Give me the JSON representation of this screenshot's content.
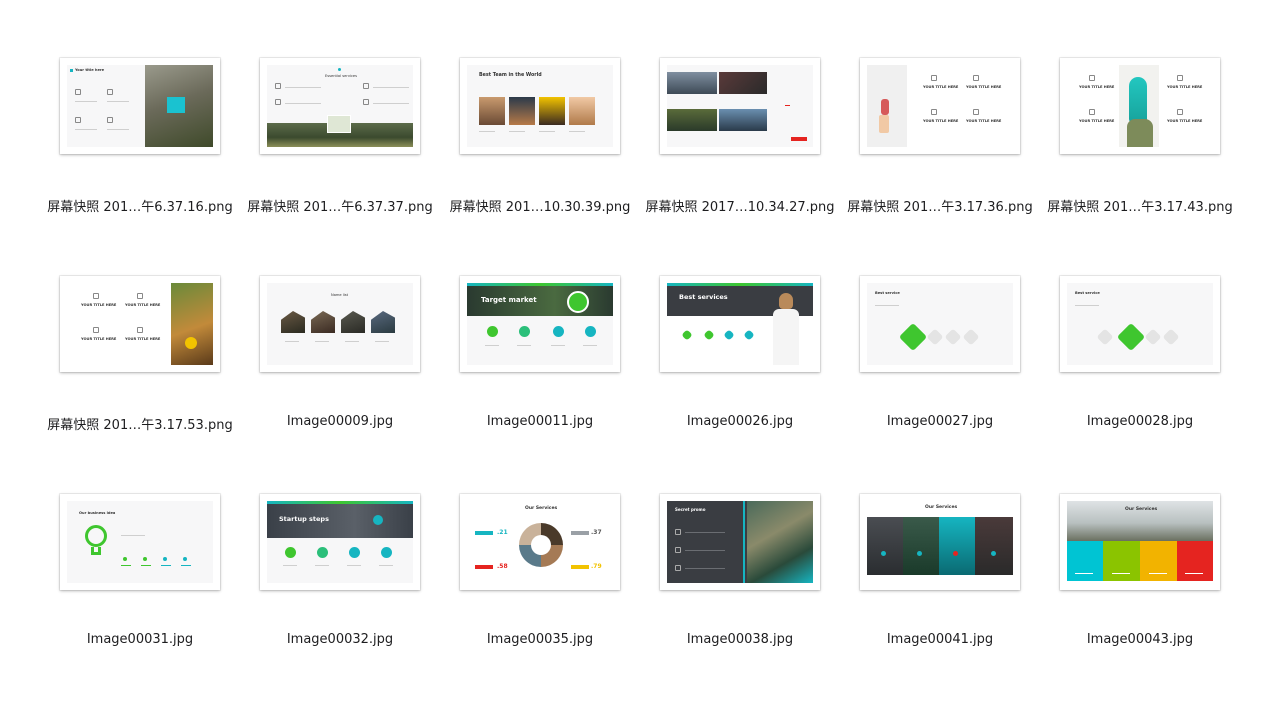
{
  "files": [
    {
      "name": "屏幕快照 201…午6.37.16.png",
      "preview_text": "Your title here"
    },
    {
      "name": "屏幕快照 201…午6.37.37.png",
      "preview_text": "Essential services"
    },
    {
      "name": "屏幕快照 201…10.30.39.png",
      "preview_text": "Best Team in the World"
    },
    {
      "name": "屏幕快照 2017…10.34.27.png",
      "preview_text": ""
    },
    {
      "name": "屏幕快照 201…午3.17.36.png",
      "preview_text": "YOUR TITLE HERE"
    },
    {
      "name": "屏幕快照 201…午3.17.43.png",
      "preview_text": "YOUR TITLE HERE"
    },
    {
      "name": "屏幕快照 201…午3.17.53.png",
      "preview_text": "YOUR TITLE HERE"
    },
    {
      "name": "Image00009.jpg",
      "preview_text": "Name list"
    },
    {
      "name": "Image00011.jpg",
      "preview_text": "Target market"
    },
    {
      "name": "Image00026.jpg",
      "preview_text": "Best services"
    },
    {
      "name": "Image00027.jpg",
      "preview_text": "Best service"
    },
    {
      "name": "Image00028.jpg",
      "preview_text": "Best service"
    },
    {
      "name": "Image00031.jpg",
      "preview_text": "Our business idea"
    },
    {
      "name": "Image00032.jpg",
      "preview_text": "Startup steps"
    },
    {
      "name": "Image00035.jpg",
      "preview_text": "Our Services"
    },
    {
      "name": "Image00038.jpg",
      "preview_text": "Secret promo"
    },
    {
      "name": "Image00041.jpg",
      "preview_text": "Our Services"
    },
    {
      "name": "Image00043.jpg",
      "preview_text": "Our Services"
    }
  ],
  "slide_numbers": {
    "a": ".21",
    "b": ".37",
    "c": ".58",
    "d": ".79"
  },
  "colors": {
    "green": "#3fc62f",
    "teal": "#16b5c1",
    "dark": "#2e3236",
    "red": "#e52420",
    "yellow": "#f2c300",
    "cyan": "#00c4d3"
  },
  "icons": [
    "photo-thumbnail"
  ]
}
